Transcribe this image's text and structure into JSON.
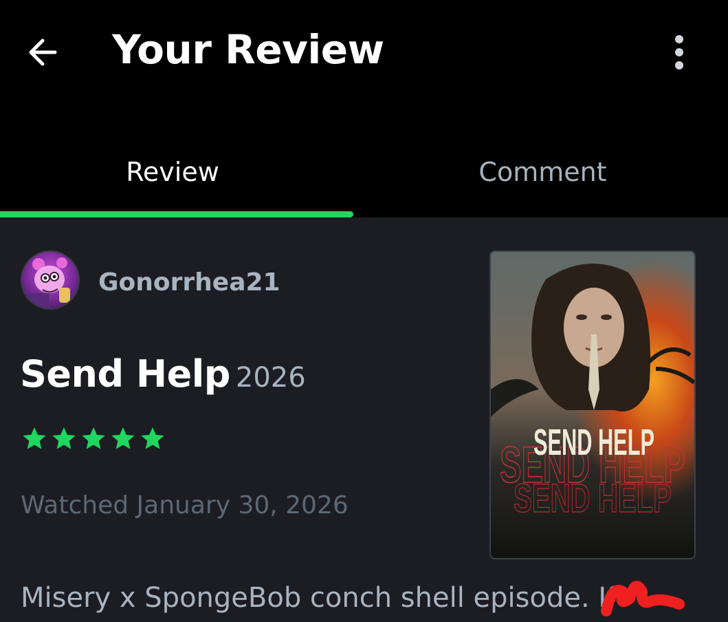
{
  "header": {
    "title": "Your Review"
  },
  "tabs": [
    {
      "label": "Review",
      "active": true
    },
    {
      "label": "Comment",
      "active": false
    }
  ],
  "review": {
    "username": "Gonorrhea21",
    "film_title": "Send Help",
    "film_year": "2026",
    "rating_stars": 5,
    "watched_text": "Watched January 30, 2026",
    "body_preview": "Misery x SpongeBob conch shell episode. If",
    "poster_text": "SEND HELP"
  },
  "colors": {
    "accent": "#1ed760",
    "background": "#1b1d22",
    "header_bg": "#000000",
    "muted_text": "#a9b4c0",
    "dim_text": "#5d6875"
  },
  "icons": {
    "back": "arrow-left-icon",
    "more": "more-vertical-icon",
    "star": "star-icon"
  }
}
